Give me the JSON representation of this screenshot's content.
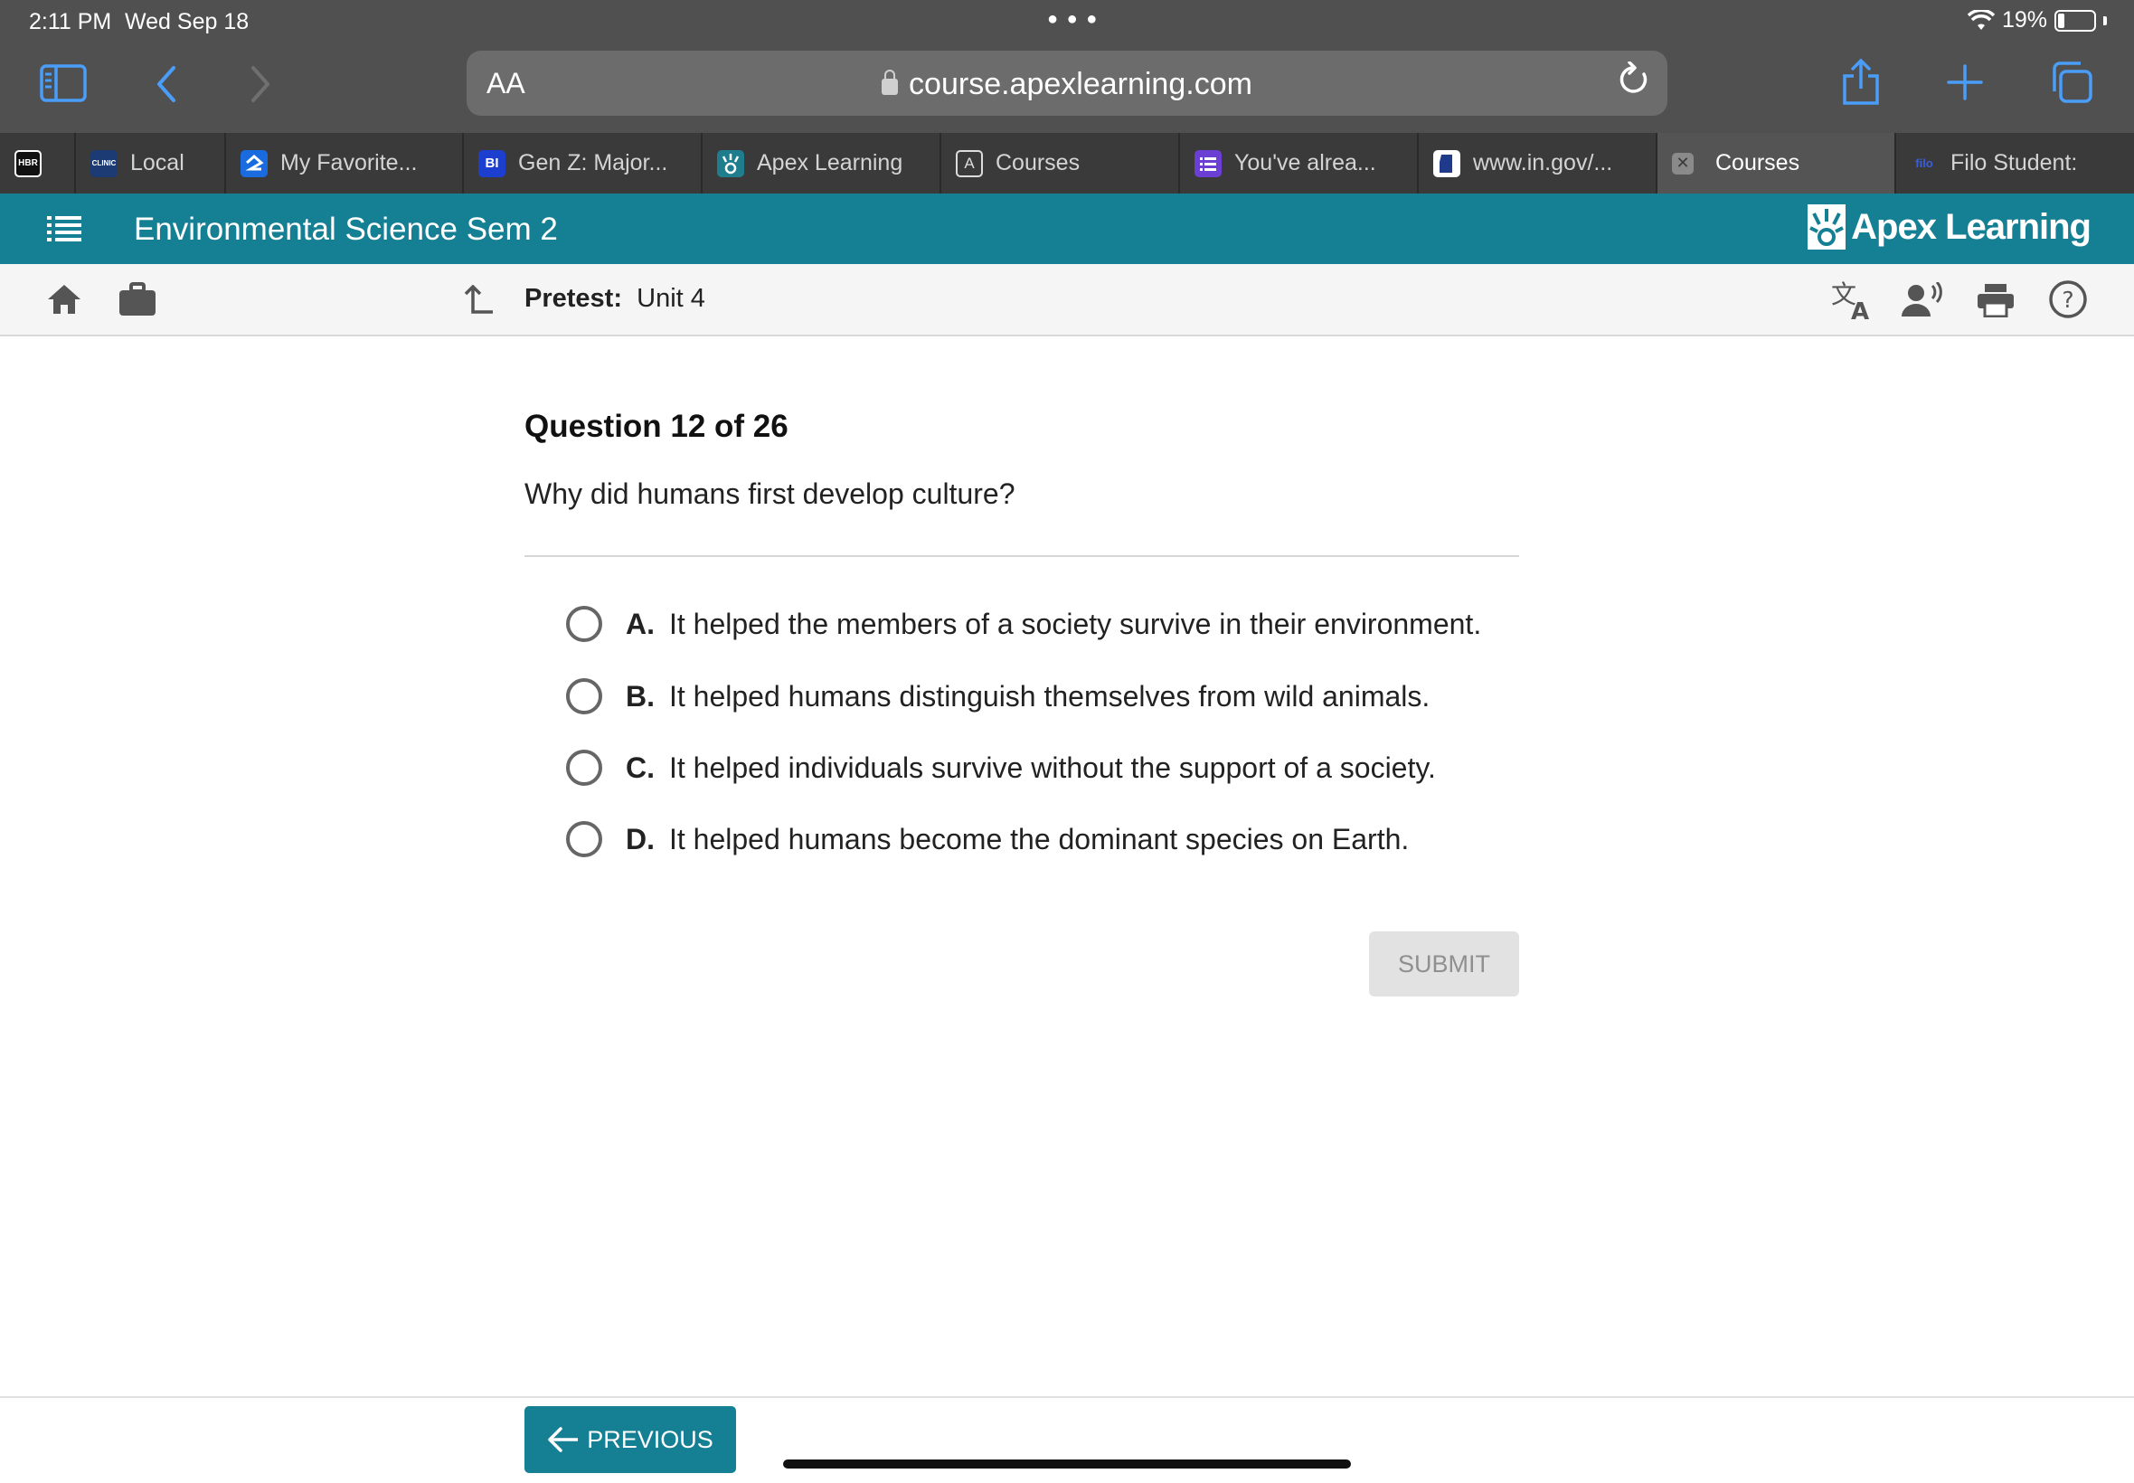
{
  "status_bar": {
    "time": "2:11 PM",
    "date": "Wed Sep 18",
    "wifi_icon": "wifi-icon",
    "battery_percent": "19%",
    "battery_level": 0.19
  },
  "browser": {
    "text_size_label": "AA",
    "url": "course.apexlearning.com",
    "tabs": [
      {
        "label": "",
        "favicon": "HBR"
      },
      {
        "label": "Local",
        "favicon": "CLINIC"
      },
      {
        "label": "My Favorite...",
        "favicon": "zillow"
      },
      {
        "label": "Gen Z: Major...",
        "favicon": "BI"
      },
      {
        "label": "Apex Learning",
        "favicon": "apex"
      },
      {
        "label": "Courses",
        "favicon": "A"
      },
      {
        "label": "You've alrea...",
        "favicon": "list"
      },
      {
        "label": "www.in.gov/...",
        "favicon": "in"
      },
      {
        "label": "Courses",
        "favicon": "close",
        "active": true
      },
      {
        "label": "Filo Student:...",
        "favicon": "filo"
      }
    ]
  },
  "app": {
    "course_title": "Environmental Science Sem 2",
    "brand": "Apex Learning",
    "breadcrumb_label": "Pretest:",
    "breadcrumb_value": "Unit 4"
  },
  "question": {
    "heading": "Question 12 of 26",
    "prompt": "Why did humans first develop culture?",
    "options": [
      {
        "letter": "A.",
        "text": "It helped the members of a society survive in their environment."
      },
      {
        "letter": "B.",
        "text": "It helped humans distinguish themselves from wild animals."
      },
      {
        "letter": "C.",
        "text": "It helped individuals survive without the support of a society."
      },
      {
        "letter": "D.",
        "text": "It helped humans become the dominant species on Earth."
      }
    ],
    "submit_label": "SUBMIT"
  },
  "footer": {
    "previous_label": "PREVIOUS"
  },
  "colors": {
    "teal": "#157f94",
    "browser_chrome": "#505050",
    "ios_blue": "#4a9df8"
  }
}
